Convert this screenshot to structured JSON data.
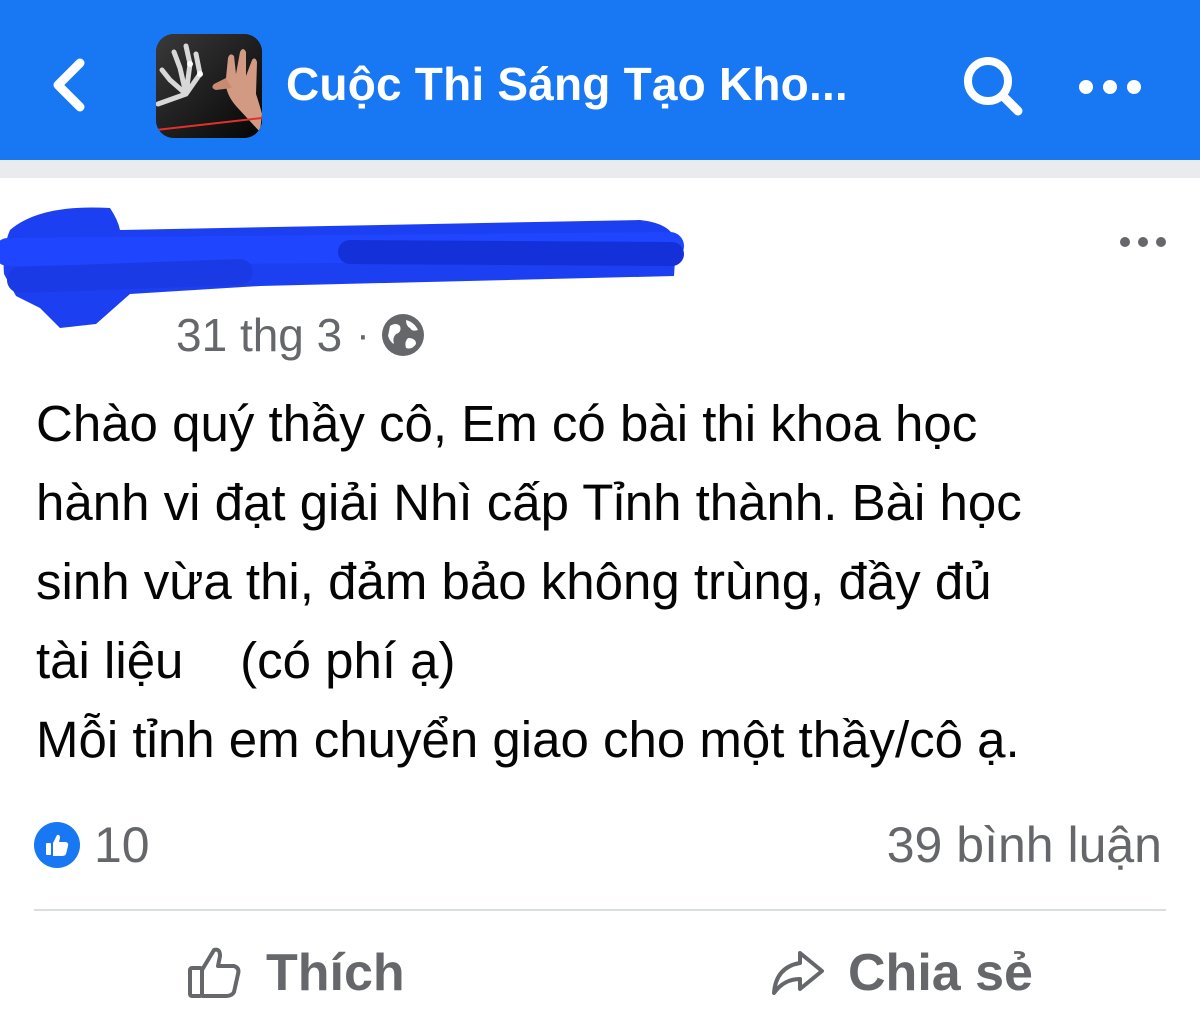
{
  "header": {
    "title": "Cuộc Thi Sáng Tạo Kho...",
    "back_icon": "chevron-left-icon",
    "search_icon": "search-icon",
    "more_icon": "more-horizontal-icon",
    "bar_color": "#1877f2"
  },
  "post": {
    "date": "31 thg 3",
    "separator": "·",
    "privacy_icon": "globe-icon",
    "more_icon": "more-horizontal-icon",
    "body_lines": [
      "Chào quý thầy cô, Em có bài thi khoa học",
      "hành vi đạt giải Nhì cấp Tỉnh thành. Bài học",
      "sinh vừa thi, đảm bảo không trùng, đầy đủ",
      "tài liệu    (có phí ạ)",
      "Mỗi tỉnh em chuyển giao cho một thầy/cô ạ."
    ],
    "reactions": {
      "icon": "thumbs-up-icon",
      "count": "10"
    },
    "comments": "39 bình luận"
  },
  "actions": {
    "like_label": "Thích",
    "like_icon": "thumbs-up-outline-icon",
    "share_label": "Chia sẻ",
    "share_icon": "share-arrow-icon"
  }
}
